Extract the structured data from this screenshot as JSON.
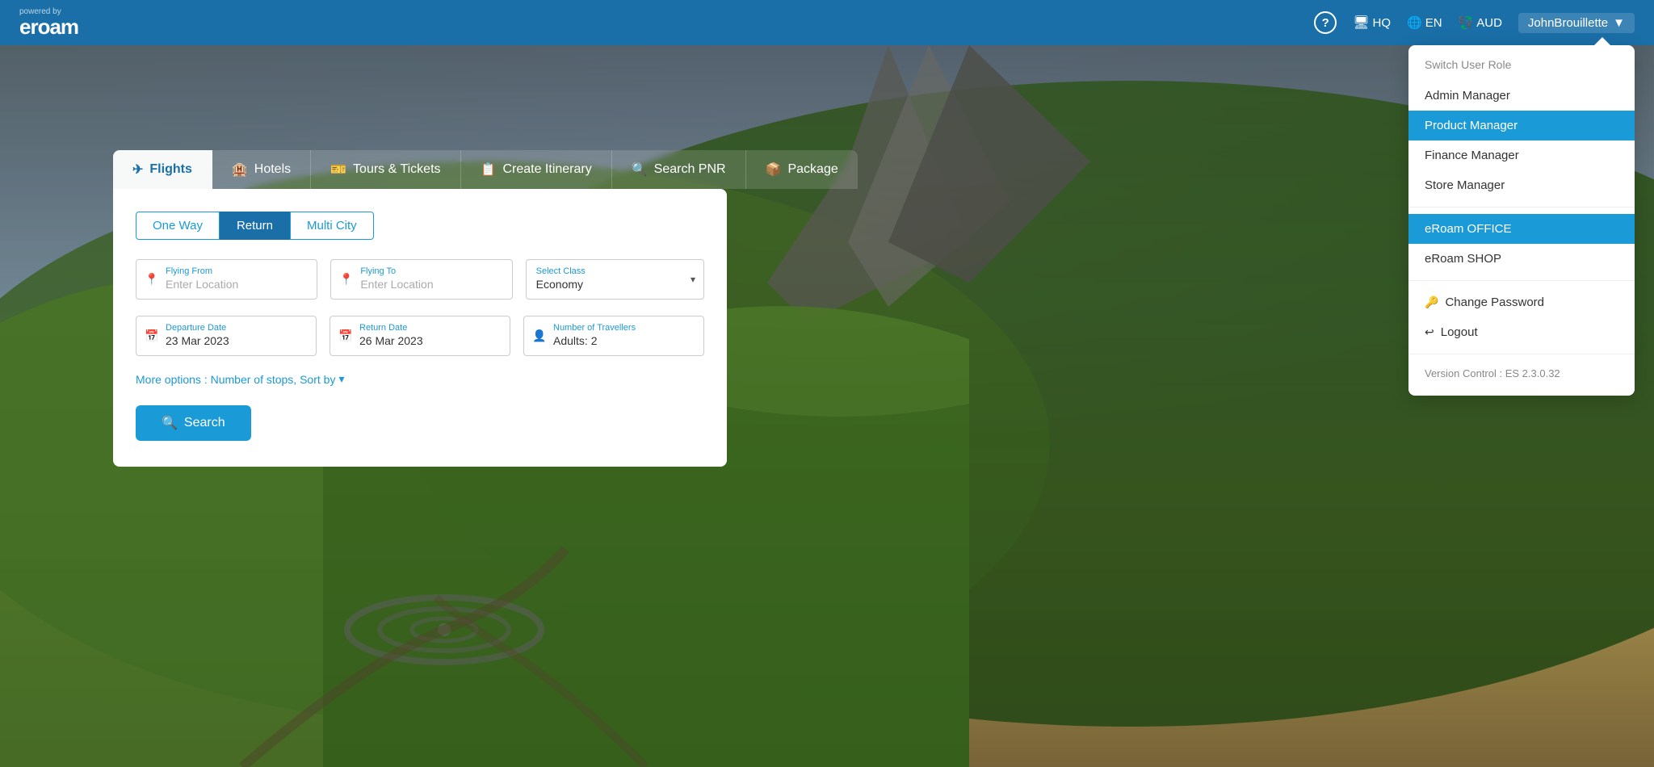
{
  "brand": {
    "powered_by": "powered by",
    "name": "eroam",
    "logo_char": "e"
  },
  "navbar": {
    "help_icon": "?",
    "hq_label": "HQ",
    "lang_label": "EN",
    "currency_label": "AUD",
    "user_label": "JohnBrouillette",
    "user_caret": "▼"
  },
  "tabs": [
    {
      "id": "flights",
      "label": "Flights",
      "icon": "✈",
      "active": true
    },
    {
      "id": "hotels",
      "label": "Hotels",
      "icon": "🏨",
      "active": false
    },
    {
      "id": "tours",
      "label": "Tours & Tickets",
      "icon": "🎫",
      "active": false
    },
    {
      "id": "itinerary",
      "label": "Create Itinerary",
      "icon": "📋",
      "active": false
    },
    {
      "id": "pnr",
      "label": "Search PNR",
      "icon": "🔍",
      "active": false
    },
    {
      "id": "package",
      "label": "Package",
      "icon": "📦",
      "active": false
    }
  ],
  "trip_types": [
    {
      "id": "one-way",
      "label": "One Way",
      "active": false
    },
    {
      "id": "return",
      "label": "Return",
      "active": true
    },
    {
      "id": "multi-city",
      "label": "Multi City",
      "active": false
    }
  ],
  "fields": {
    "flying_from": {
      "label": "Flying From",
      "placeholder": "Enter Location",
      "value": ""
    },
    "flying_to": {
      "label": "Flying To",
      "placeholder": "Enter Location",
      "value": ""
    },
    "select_class": {
      "label": "Select Class",
      "value": "Economy"
    },
    "departure_date": {
      "label": "Departure Date",
      "value": "23 Mar 2023"
    },
    "return_date": {
      "label": "Return Date",
      "value": "26 Mar 2023"
    },
    "travellers": {
      "label": "Number of Travellers",
      "value": "Adults: 2"
    }
  },
  "more_options": {
    "label": "More options : Number of stops, Sort by",
    "icon": "▾"
  },
  "search_button": {
    "label": "Search",
    "icon": "🔍"
  },
  "dropdown": {
    "title": "Switch User Role",
    "items": [
      {
        "id": "admin",
        "label": "Admin Manager",
        "active": false
      },
      {
        "id": "product",
        "label": "Product Manager",
        "active": true
      },
      {
        "id": "finance",
        "label": "Finance Manager",
        "active": false
      },
      {
        "id": "store",
        "label": "Store Manager",
        "active": false
      }
    ],
    "office_items": [
      {
        "id": "office",
        "label": "eRoam OFFICE",
        "active": true
      },
      {
        "id": "shop",
        "label": "eRoam SHOP",
        "active": false
      }
    ],
    "actions": [
      {
        "id": "change-password",
        "label": "Change Password",
        "icon": "🔑"
      },
      {
        "id": "logout",
        "label": "Logout",
        "icon": "↩"
      }
    ],
    "version": "Version Control : ES 2.3.0.32"
  }
}
